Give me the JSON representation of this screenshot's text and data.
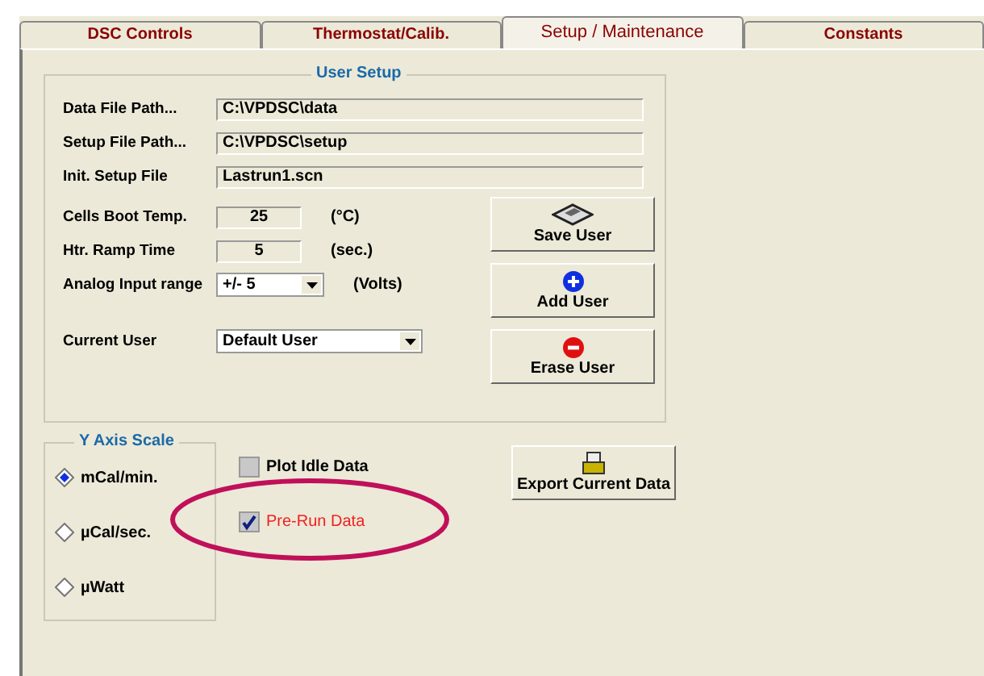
{
  "tabs": [
    {
      "label": "DSC Controls",
      "selected": false
    },
    {
      "label": "Thermostat/Calib.",
      "selected": false
    },
    {
      "label": "Setup / Maintenance",
      "selected": true
    },
    {
      "label": "Constants",
      "selected": false
    }
  ],
  "user_setup": {
    "title": "User Setup",
    "paths": [
      {
        "label": "Data File Path...",
        "value": "C:\\VPDSC\\data"
      },
      {
        "label": "Setup File Path...",
        "value": "C:\\VPDSC\\setup"
      },
      {
        "label": "Init. Setup File",
        "value": "Lastrun1.scn"
      }
    ],
    "numeric": [
      {
        "label": "Cells Boot Temp.",
        "value": "25",
        "unit": "(°C)"
      },
      {
        "label": "Htr. Ramp Time",
        "value": "5",
        "unit": "(sec.)"
      }
    ],
    "analog": {
      "label": "Analog Input range",
      "value": "+/- 5",
      "unit": "(Volts)"
    },
    "current_user": {
      "label": "Current User",
      "value": "Default User"
    },
    "buttons": [
      {
        "label": "Save User",
        "kind": "save"
      },
      {
        "label": "Add User",
        "kind": "add"
      },
      {
        "label": "Erase User",
        "kind": "erase"
      }
    ]
  },
  "y_axis_scale": {
    "title": "Y Axis Scale",
    "options": [
      {
        "label": "mCal/min.",
        "selected": true
      },
      {
        "label": "µCal/sec.",
        "selected": false
      },
      {
        "label": "µWatt",
        "selected": false
      }
    ]
  },
  "checkboxes": [
    {
      "label": "Plot Idle Data",
      "checked": false,
      "highlighted": false
    },
    {
      "label": "Pre-Run Data",
      "checked": true,
      "highlighted": true
    }
  ],
  "export_button": {
    "label": "Export Current Data"
  }
}
